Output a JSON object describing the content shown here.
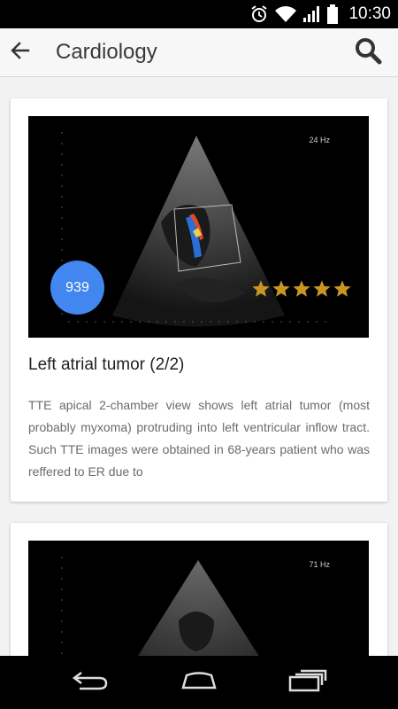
{
  "status_bar": {
    "time": "10:30",
    "icons": [
      "alarm-icon",
      "wifi-icon",
      "signal-icon",
      "battery-icon"
    ]
  },
  "app_bar": {
    "title": "Cardiology",
    "back_icon": "arrow-left-icon",
    "search_icon": "search-icon"
  },
  "cards": [
    {
      "hz": "24 Hz",
      "count": "939",
      "rating": 5,
      "title": "Left atrial tumor (2/2)",
      "description": "TTE apical 2-chamber view shows left atrial tumor (most probably myxoma) protruding into left ventricular inflow tract. Such TTE images were obtained in 68-years patient who was reffered to ER due to"
    },
    {
      "hz": "71 Hz"
    }
  ],
  "nav_bar": {
    "icons": [
      "back-icon",
      "home-icon",
      "recents-icon"
    ]
  },
  "colors": {
    "badge": "#4286f0",
    "star": "#c9961f",
    "status_bar": "#000000",
    "nav_bar": "#000000"
  }
}
